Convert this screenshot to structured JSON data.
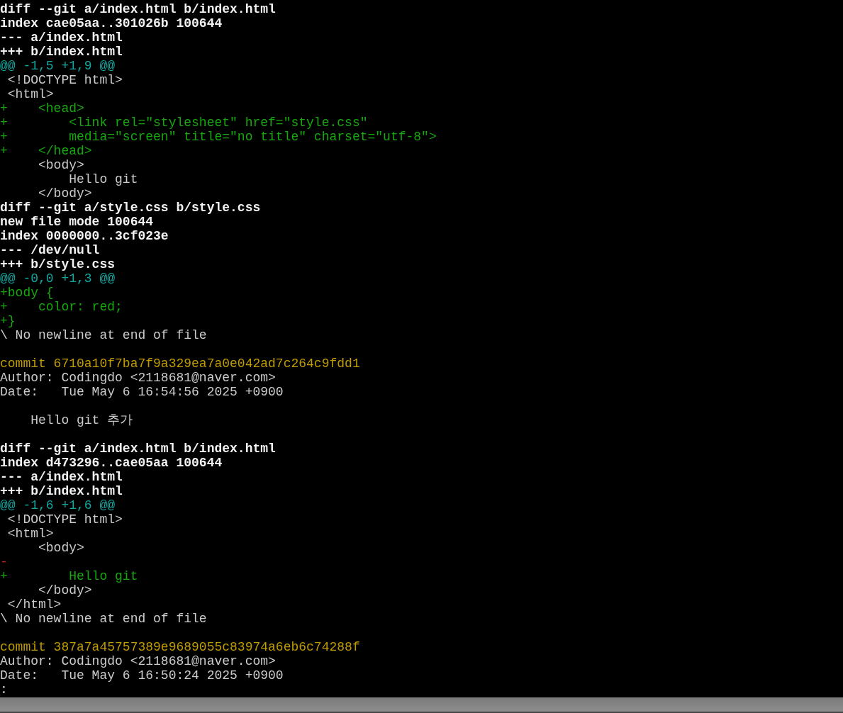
{
  "terminal": {
    "lines": [
      {
        "kind": "header",
        "text": "diff --git a/index.html b/index.html"
      },
      {
        "kind": "header",
        "text": "index cae05aa..301026b 100644"
      },
      {
        "kind": "header",
        "text": "--- a/index.html"
      },
      {
        "kind": "header",
        "text": "+++ b/index.html"
      },
      {
        "kind": "hunk",
        "text": "@@ -1,5 +1,9 @@"
      },
      {
        "kind": "context",
        "text": " <!DOCTYPE html>"
      },
      {
        "kind": "context",
        "text": " <html>"
      },
      {
        "kind": "add",
        "text": "+    <head>"
      },
      {
        "kind": "add",
        "text": "+        <link rel=\"stylesheet\" href=\"style.css\""
      },
      {
        "kind": "add",
        "text": "+        media=\"screen\" title=\"no title\" charset=\"utf-8\">"
      },
      {
        "kind": "add",
        "text": "+    </head>"
      },
      {
        "kind": "context",
        "text": "     <body>"
      },
      {
        "kind": "context",
        "text": "         Hello git"
      },
      {
        "kind": "context",
        "text": "     </body>"
      },
      {
        "kind": "header",
        "text": "diff --git a/style.css b/style.css"
      },
      {
        "kind": "header",
        "text": "new file mode 100644"
      },
      {
        "kind": "header",
        "text": "index 0000000..3cf023e"
      },
      {
        "kind": "header",
        "text": "--- /dev/null"
      },
      {
        "kind": "header",
        "text": "+++ b/style.css"
      },
      {
        "kind": "hunk",
        "text": "@@ -0,0 +1,3 @@"
      },
      {
        "kind": "add",
        "text": "+body {"
      },
      {
        "kind": "add",
        "text": "+    color: red;"
      },
      {
        "kind": "add",
        "text": "+}"
      },
      {
        "kind": "context",
        "text": "\\ No newline at end of file"
      },
      {
        "kind": "blank"
      },
      {
        "kind": "commit",
        "text": "commit 6710a10f7ba7f9a329ea7a0e042ad7c264c9fdd1"
      },
      {
        "kind": "context",
        "text": "Author: Codingdo <2118681@naver.com>"
      },
      {
        "kind": "context",
        "text": "Date:   Tue May 6 16:54:56 2025 +0900"
      },
      {
        "kind": "blank"
      },
      {
        "kind": "context",
        "text": "    Hello git 추가"
      },
      {
        "kind": "blank"
      },
      {
        "kind": "header",
        "text": "diff --git a/index.html b/index.html"
      },
      {
        "kind": "header",
        "text": "index d473296..cae05aa 100644"
      },
      {
        "kind": "header",
        "text": "--- a/index.html"
      },
      {
        "kind": "header",
        "text": "+++ b/index.html"
      },
      {
        "kind": "hunk",
        "text": "@@ -1,6 +1,6 @@"
      },
      {
        "kind": "context",
        "text": " <!DOCTYPE html>"
      },
      {
        "kind": "context",
        "text": " <html>"
      },
      {
        "kind": "context",
        "text": "     <body>"
      },
      {
        "kind": "del",
        "text": "-"
      },
      {
        "kind": "add",
        "text": "+        Hello git"
      },
      {
        "kind": "context",
        "text": "     </body>"
      },
      {
        "kind": "context",
        "text": " </html>"
      },
      {
        "kind": "context",
        "text": "\\ No newline at end of file"
      },
      {
        "kind": "blank"
      },
      {
        "kind": "commit",
        "text": "commit 387a7a45757389e9689055c83974a6eb6c74288f"
      },
      {
        "kind": "context",
        "text": "Author: Codingdo <2118681@naver.com>"
      },
      {
        "kind": "context",
        "text": "Date:   Tue May 6 16:50:24 2025 +0900"
      },
      {
        "kind": "prompt",
        "text": ":"
      }
    ]
  }
}
